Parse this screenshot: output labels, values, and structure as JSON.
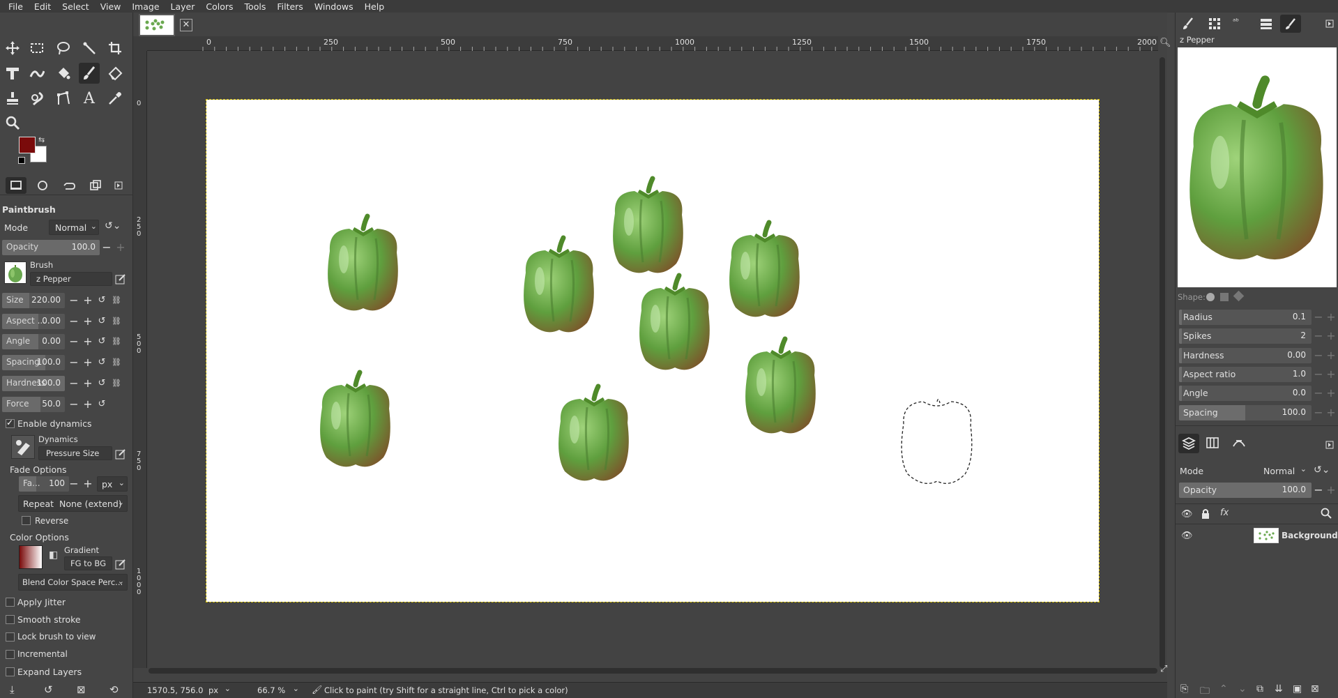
{
  "menubar": [
    "File",
    "Edit",
    "Select",
    "View",
    "Image",
    "Layer",
    "Colors",
    "Tools",
    "Filters",
    "Windows",
    "Help"
  ],
  "toolbox": {
    "tools": [
      "move-tool",
      "rect-select-tool",
      "free-select-tool",
      "fuzzy-select-tool",
      "crop-tool",
      "unified-transform-tool",
      "warp-transform-tool",
      "bucket-fill-tool",
      "paintbrush-tool",
      "eraser-tool",
      "clone-tool",
      "smudge-tool",
      "paths-tool",
      "text-tool",
      "color-picker-tool",
      "zoom-tool"
    ],
    "fg_color": "#7a0b0b",
    "bg_color": "#ffffff"
  },
  "tool_options": {
    "title": "Paintbrush",
    "mode_label": "Mode",
    "mode_value": "Normal",
    "opacity_label": "Opacity",
    "opacity_value": "100.0",
    "brush_label": "Brush",
    "brush_value": "z Pepper",
    "size_label": "Size",
    "size_value": "220.00",
    "aspect_label": "Aspect ...",
    "aspect_value": "0.00",
    "angle_label": "Angle",
    "angle_value": "0.00",
    "spacing_label": "Spacing",
    "spacing_value": "100.0",
    "hardness_label": "Hardness",
    "hardness_value": "100.0",
    "force_label": "Force",
    "force_value": "50.0",
    "enable_dynamics": "Enable dynamics",
    "dynamics_label": "Dynamics",
    "dynamics_value": "Pressure Size",
    "fade_options": "Fade Options",
    "fade_label": "Fa...",
    "fade_value": "100",
    "fade_unit": "px",
    "repeat_label": "Repeat",
    "repeat_value": "None (extend)",
    "reverse": "Reverse",
    "color_options": "Color Options",
    "gradient_label": "Gradient",
    "gradient_value": "FG to BG",
    "blend_value": "Blend Color Space Perc...",
    "apply_jitter": "Apply Jitter",
    "smooth_stroke": "Smooth stroke",
    "lock_brush": "Lock brush to view",
    "incremental": "Incremental",
    "expand_layers": "Expand Layers"
  },
  "ruler": {
    "h_ticks": [
      "0",
      "250",
      "500",
      "750",
      "1000",
      "1250",
      "1500",
      "1750",
      "2000"
    ],
    "v_ticks": [
      "0",
      "250",
      "500",
      "750",
      "1000"
    ]
  },
  "status": {
    "coords": "1570.5, 756.0",
    "unit": "px",
    "zoom": "66.7 %",
    "message": "Click to paint (try Shift for a straight line, Ctrl to pick a color)"
  },
  "brush_editor": {
    "name": "z Pepper",
    "shape_label": "Shape:",
    "radius_label": "Radius",
    "radius_value": "0.1",
    "spikes_label": "Spikes",
    "spikes_value": "2",
    "hardness_label": "Hardness",
    "hardness_value": "0.00",
    "aspect_label": "Aspect ratio",
    "aspect_value": "1.0",
    "angle_label": "Angle",
    "angle_value": "0.0",
    "spacing_label": "Spacing",
    "spacing_value": "100.0"
  },
  "layers": {
    "mode_label": "Mode",
    "mode_value": "Normal",
    "opacity_label": "Opacity",
    "opacity_value": "100.0",
    "items": [
      {
        "name": "Background"
      }
    ]
  }
}
